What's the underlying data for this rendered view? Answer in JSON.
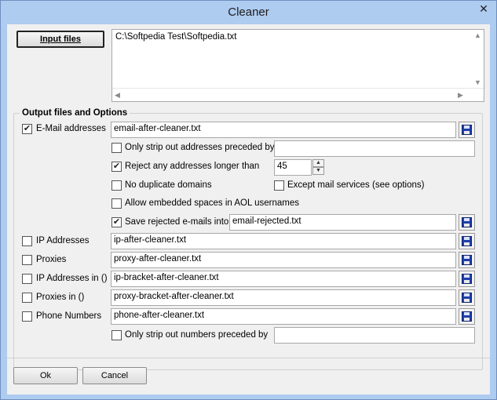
{
  "window": {
    "title": "Cleaner",
    "close_glyph": "✕"
  },
  "input": {
    "button_label": "Input files",
    "files": [
      "C:\\Softpedia Test\\Softpedia.txt"
    ]
  },
  "output": {
    "group_title": "Output files and Options",
    "email": {
      "label": "E-Mail addresses",
      "checked": true,
      "file": "email-after-cleaner.txt"
    },
    "only_strip": {
      "label": "Only strip out addresses preceded by",
      "checked": false,
      "value": ""
    },
    "reject_longer": {
      "label": "Reject any addresses longer than",
      "checked": true,
      "value": "45"
    },
    "no_dup_domains": {
      "label": "No duplicate domains",
      "checked": false
    },
    "except_mail": {
      "label": "Except mail services (see options)",
      "checked": false
    },
    "allow_spaces": {
      "label": "Allow embedded spaces in AOL usernames",
      "checked": false
    },
    "save_rejected": {
      "label": "Save rejected e-mails into",
      "checked": true,
      "file": "email-rejected.txt"
    },
    "ip": {
      "label": "IP Addresses",
      "checked": false,
      "file": "ip-after-cleaner.txt"
    },
    "proxies": {
      "label": "Proxies",
      "checked": false,
      "file": "proxy-after-cleaner.txt"
    },
    "ip_bracket": {
      "label": "IP Addresses in ()",
      "checked": false,
      "file": "ip-bracket-after-cleaner.txt"
    },
    "proxies_bracket": {
      "label": "Proxies in ()",
      "checked": false,
      "file": "proxy-bracket-after-cleaner.txt"
    },
    "phone": {
      "label": "Phone Numbers",
      "checked": false,
      "file": "phone-after-cleaner.txt"
    },
    "only_strip_numbers": {
      "label": "Only strip out numbers preceded by",
      "checked": false,
      "value": ""
    }
  },
  "buttons": {
    "ok": "Ok",
    "cancel": "Cancel"
  },
  "check_glyph": "✔",
  "icons": {
    "save": "floppy-disk-icon",
    "scroll_up": "▲",
    "scroll_down": "▼",
    "scroll_left": "◀",
    "scroll_right": "▶"
  },
  "colors": {
    "titlebar": "#aecbf0",
    "client": "#f0f0f0",
    "disk": "#1f3fa8"
  }
}
